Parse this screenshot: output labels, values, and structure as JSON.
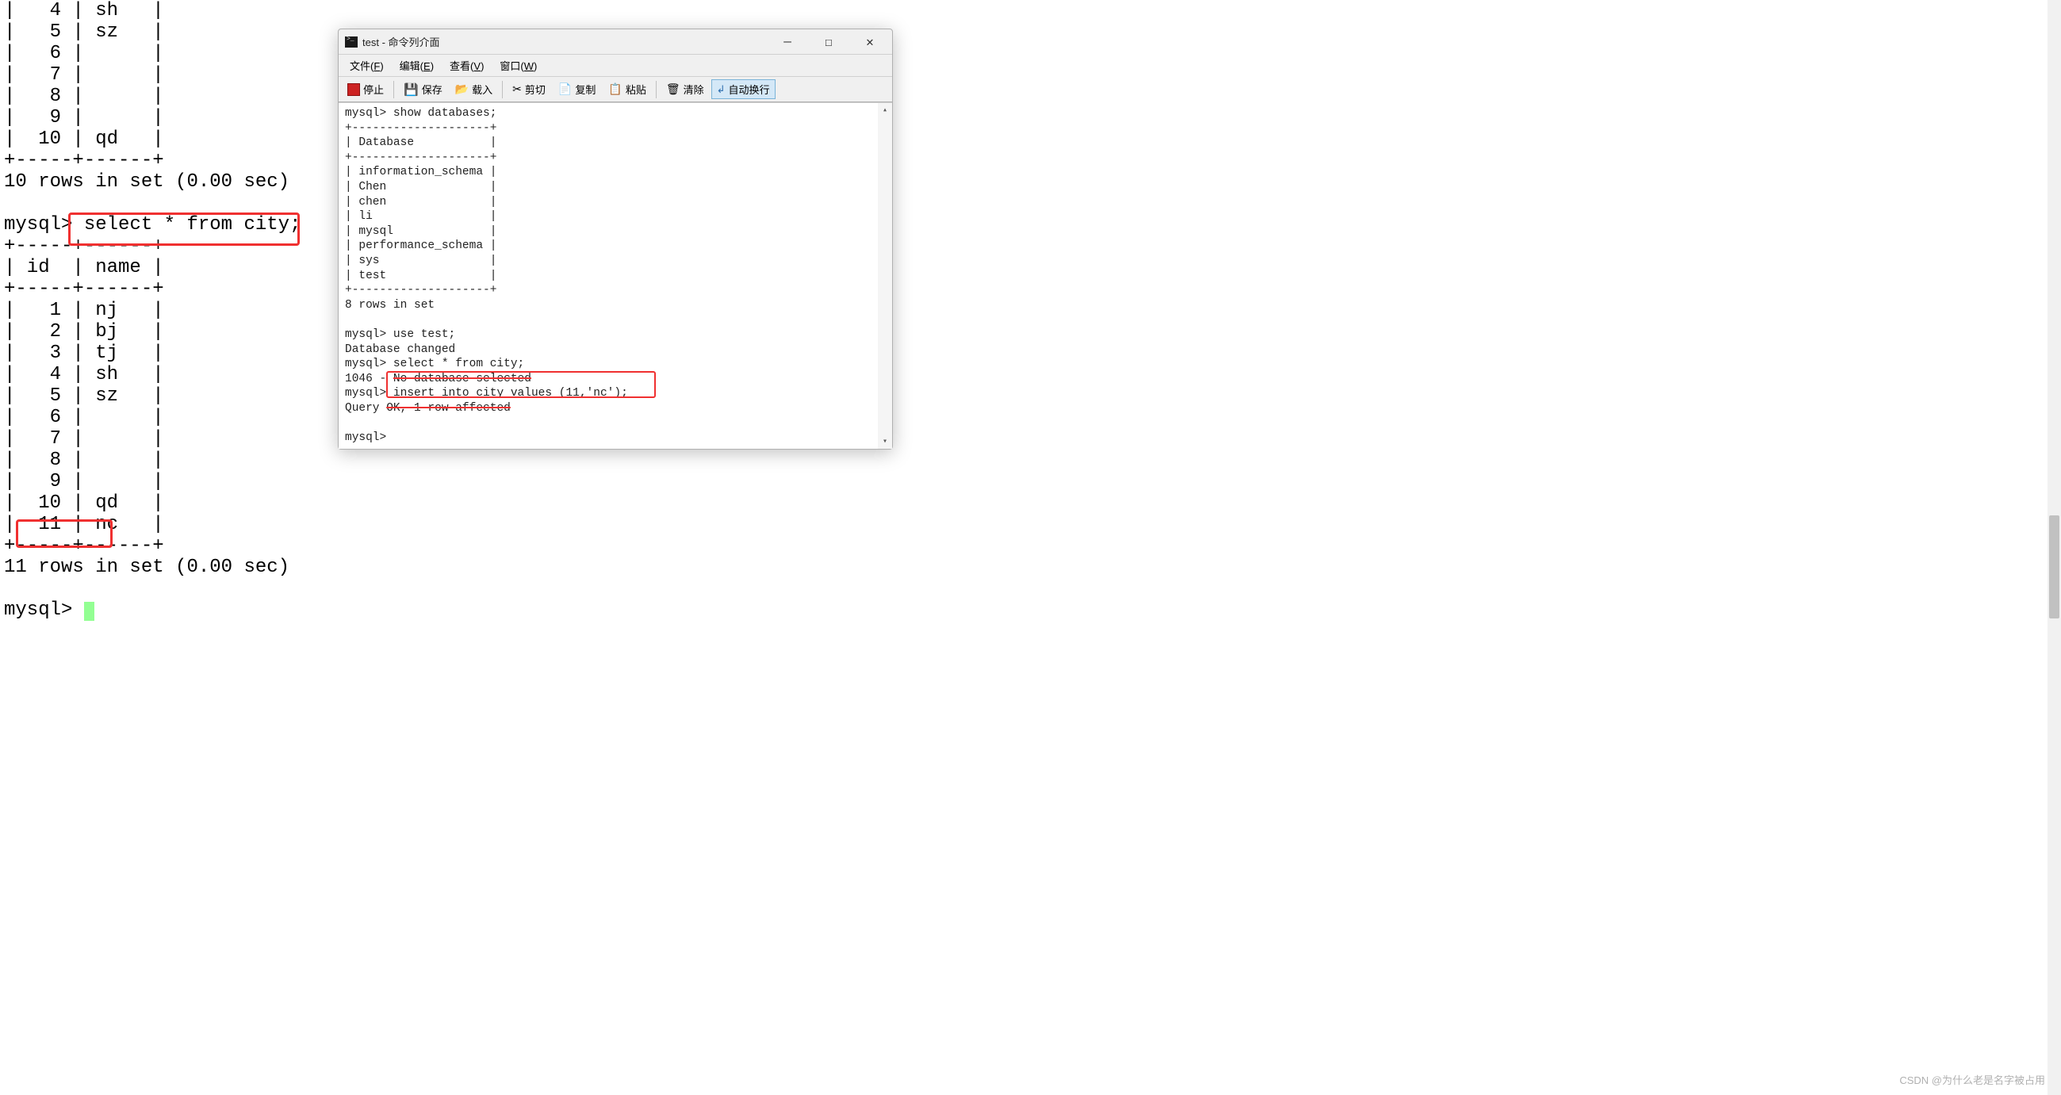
{
  "bg_terminal": {
    "lines_top": [
      "|   4 | sh   |",
      "|   5 | sz   |",
      "|   6 |      |",
      "|   7 |      |",
      "|   8 |      |",
      "|   9 |      |",
      "|  10 | qd   |",
      "+-----+------+",
      "10 rows in set (0.00 sec)",
      ""
    ],
    "prompt1": "mysql> ",
    "query1": "select * from city;",
    "table2_head": [
      "+-----+------+",
      "| id  | name |",
      "+-----+------+"
    ],
    "table2_rows": [
      "|   1 | nj   |",
      "|   2 | bj   |",
      "|   3 | tj   |",
      "|   4 | sh   |",
      "|   5 | sz   |",
      "|   6 |      |",
      "|   7 |      |",
      "|   8 |      |",
      "|   9 |      |",
      "|  10 | qd   |"
    ],
    "row11_pre": "|  ",
    "row11_boxed": "11 | nc",
    "row11_post": "   |",
    "table2_foot": "+-----+------+",
    "result2": "11 rows in set (0.00 sec)",
    "prompt_end": "mysql> "
  },
  "window": {
    "title": "test - 命令列介面",
    "menu": {
      "file": "文件",
      "file_u": "F",
      "edit": "编辑",
      "edit_u": "E",
      "view": "查看",
      "view_u": "V",
      "window": "窗口",
      "window_u": "W"
    },
    "toolbar": {
      "stop": "停止",
      "save": "保存",
      "load": "载入",
      "cut": "剪切",
      "copy": "复制",
      "paste": "粘贴",
      "clear": "清除",
      "wrap": "自动换行"
    },
    "content": {
      "l1": "mysql> show databases;",
      "l2": "+--------------------+",
      "l3": "| Database           |",
      "l4": "+--------------------+",
      "l5": "| information_schema |",
      "l6": "| Chen               |",
      "l7": "| chen               |",
      "l8": "| li                 |",
      "l9": "| mysql              |",
      "l10": "| performance_schema |",
      "l11": "| sys                |",
      "l12": "| test               |",
      "l13": "+--------------------+",
      "l14": "8 rows in set",
      "l15": "",
      "l16": "mysql> use test;",
      "l17": "Database changed",
      "l18": "mysql> select * from city;",
      "l19a": "1046 - ",
      "l19b": "No database selected",
      "l20a": "mysql> ",
      "l20b": "insert into city values (11,'nc');",
      "l21a": "Query ",
      "l21b": "OK, 1 row affected",
      "l22": "",
      "l23": "mysql> "
    }
  },
  "watermark": "CSDN @为什么老是名字被占用"
}
